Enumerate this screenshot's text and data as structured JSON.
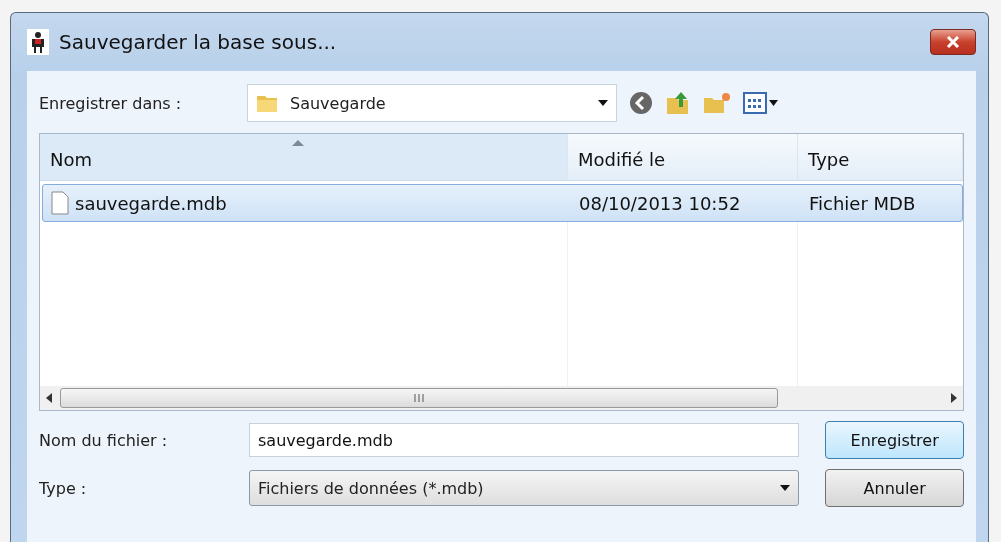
{
  "window": {
    "title": "Sauvegarder la base sous..."
  },
  "location": {
    "label": "Enregistrer dans :",
    "folder": "Sauvegarde"
  },
  "table": {
    "columns": [
      {
        "label": "Nom",
        "sorted": true
      },
      {
        "label": "Modifié le",
        "sorted": false
      },
      {
        "label": "Type",
        "sorted": false
      }
    ],
    "rows": [
      {
        "name": "sauvegarde.mdb",
        "modified": "08/10/2013 10:52",
        "type": "Fichier MDB",
        "selected": true
      }
    ]
  },
  "filename": {
    "label": "Nom du fichier :",
    "value": "sauvegarde.mdb"
  },
  "filetype": {
    "label": "Type :",
    "value": "Fichiers de données (*.mdb)"
  },
  "buttons": [
    {
      "label": "Enregistrer",
      "default": true
    },
    {
      "label": "Annuler",
      "default": false
    }
  ]
}
